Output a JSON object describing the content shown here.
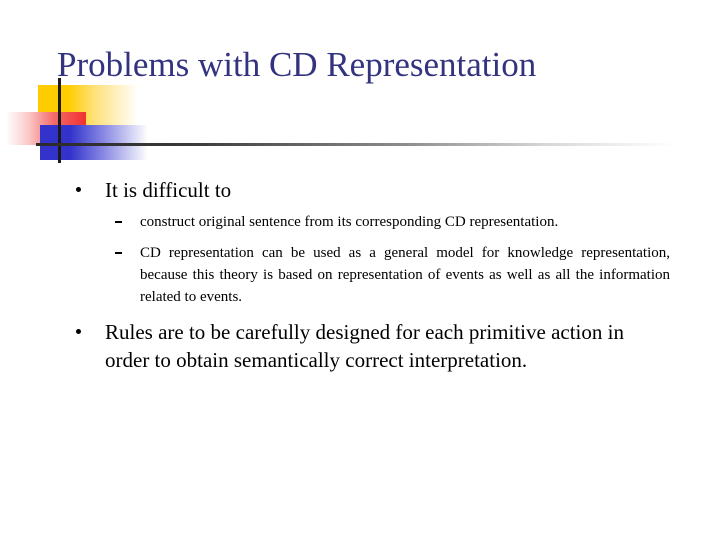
{
  "slide": {
    "title": "Problems with CD Representation",
    "title_color": "#333380",
    "background_color": "#ffffff",
    "decor": {
      "yellow": "#FFCC00",
      "red": "#F23030",
      "blue": "#3333CC",
      "rule": "#2b2b2b"
    },
    "bullets": [
      {
        "level": 1,
        "text": "It is difficult to",
        "marker": "disc-bullet",
        "children": [
          {
            "level": 2,
            "marker": "dash-bullet",
            "text": "construct original sentence from its corresponding CD representation."
          },
          {
            "level": 2,
            "marker": "dash-bullet",
            "text": "CD representation can be used as a general model for knowledge representation, because this theory is based on representation of events as well as all the information related to events."
          }
        ]
      },
      {
        "level": 1,
        "marker": "disc-bullet",
        "text": "Rules are to be carefully designed for each primitive action in order to obtain semantically correct interpretation."
      }
    ]
  }
}
